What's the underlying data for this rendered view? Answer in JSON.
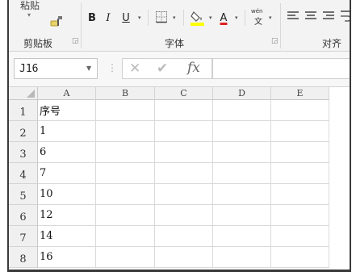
{
  "ribbon": {
    "clipboard": {
      "paste_label": "粘贴",
      "group_label": "剪贴板"
    },
    "font": {
      "group_label": "字体",
      "bold": "B",
      "italic": "I",
      "underline": "U",
      "font_color_letter": "A",
      "phonetic_top": "wén",
      "phonetic_bottom": "文"
    },
    "alignment": {
      "group_label": "对齐方"
    },
    "colors": {
      "fill_highlight": "#ffff00",
      "font_color": "#e02020"
    }
  },
  "formula_bar": {
    "name_box": "J16",
    "cancel_icon": "✕",
    "enter_icon": "✔",
    "function_label": "fx",
    "value": ""
  },
  "sheet": {
    "columns": [
      "A",
      "B",
      "C",
      "D",
      "E"
    ],
    "rows": [
      {
        "num": "1",
        "a": "序号"
      },
      {
        "num": "2",
        "a": "1"
      },
      {
        "num": "3",
        "a": "6"
      },
      {
        "num": "4",
        "a": "7"
      },
      {
        "num": "5",
        "a": "10"
      },
      {
        "num": "6",
        "a": "12"
      },
      {
        "num": "7",
        "a": "14"
      },
      {
        "num": "8",
        "a": "16"
      }
    ]
  }
}
